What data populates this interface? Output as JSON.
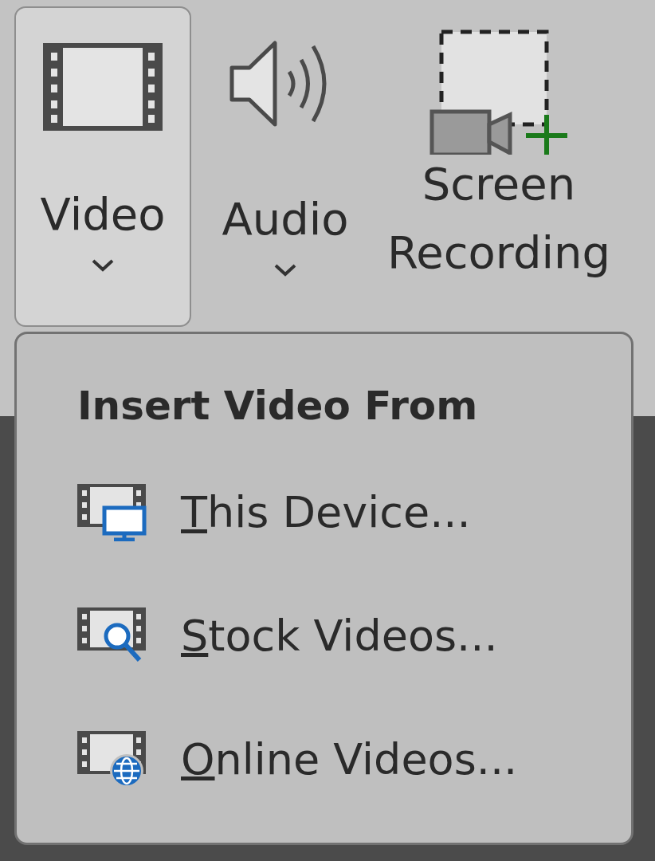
{
  "ribbon_buttons": [
    {
      "kind": "video",
      "label_lines": [
        "Video"
      ],
      "dropdown": true,
      "selected": true
    },
    {
      "kind": "audio",
      "label_lines": [
        "Audio"
      ],
      "dropdown": true,
      "selected": false
    },
    {
      "kind": "screen",
      "label_lines": [
        "Screen",
        "Recording"
      ],
      "dropdown": false,
      "selected": false
    }
  ],
  "menu": {
    "title": "Insert Video From",
    "items": [
      {
        "kind": "device",
        "label": "This Device..."
      },
      {
        "kind": "stock",
        "label": "Stock Videos..."
      },
      {
        "kind": "online",
        "label": "Online Videos..."
      }
    ]
  }
}
